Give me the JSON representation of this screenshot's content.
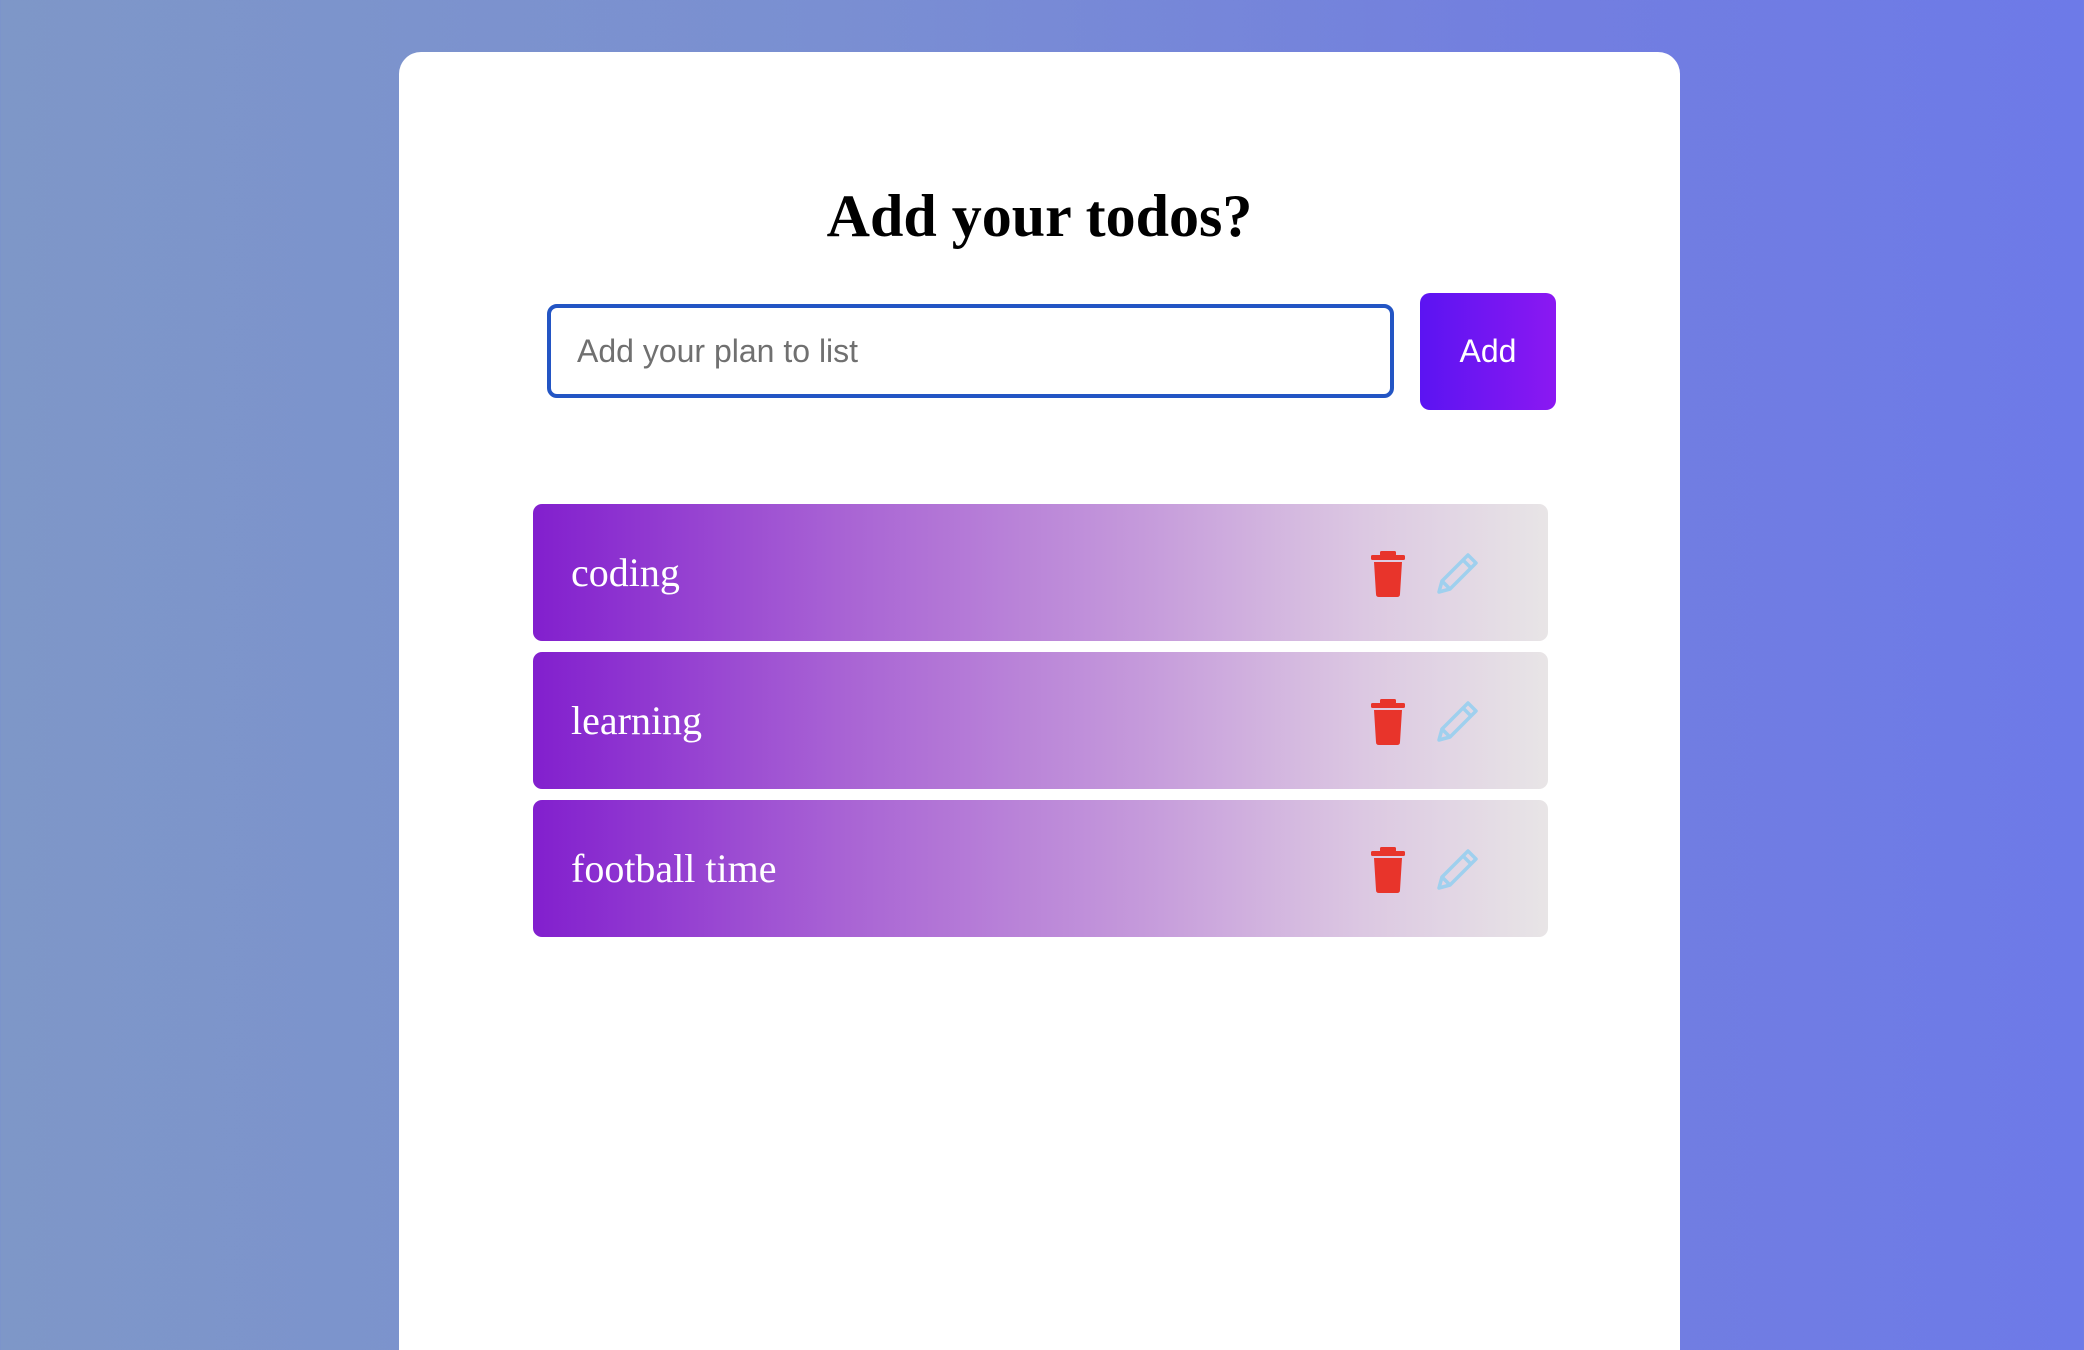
{
  "header": {
    "title": "Add your todos?"
  },
  "form": {
    "input_placeholder": "Add your plan to list",
    "input_value": "",
    "add_label": "Add"
  },
  "todos": [
    {
      "text": "coding"
    },
    {
      "text": "learning"
    },
    {
      "text": "football time"
    }
  ],
  "icons": {
    "delete": "trash-icon",
    "edit": "pencil-icon"
  },
  "colors": {
    "input_border": "#2355c4",
    "add_button_start": "#5b14f2",
    "add_button_end": "#8b18f2",
    "todo_gradient_start": "#821fce",
    "todo_gradient_end": "#e8e5e6",
    "delete_icon": "#e8342b",
    "edit_icon": "#9fd0ee"
  }
}
